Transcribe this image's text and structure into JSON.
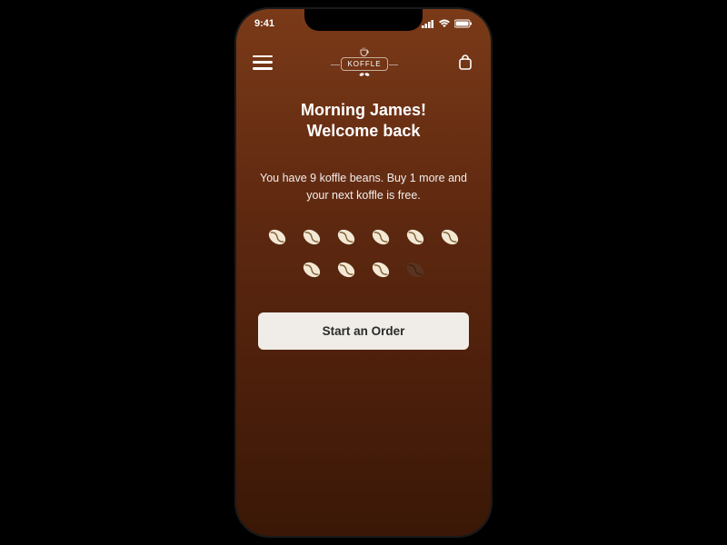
{
  "status": {
    "time": "9:41"
  },
  "brand": {
    "name": "KOFFLE"
  },
  "greeting": {
    "line1": "Morning James!",
    "line2": "Welcome back"
  },
  "loyalty": {
    "message": "You have 9 koffle beans. Buy 1 more and your next koffle is free.",
    "beans_earned": 9,
    "beans_total": 10
  },
  "cta": {
    "start_order": "Start an Order"
  },
  "colors": {
    "bean_filled": "#f3e8d4",
    "bean_empty": "#5a3320"
  }
}
